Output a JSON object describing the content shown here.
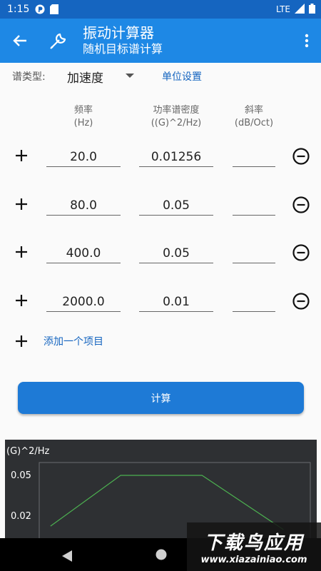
{
  "status": {
    "time": "1:15",
    "network": "LTE"
  },
  "app": {
    "title": "振动计算器",
    "subtitle": "随机目标谱计算"
  },
  "controls": {
    "type_label": "谱类型:",
    "type_value": "加速度",
    "unit_link": "单位设置"
  },
  "columns": [
    {
      "line1": "频率",
      "line2": "(Hz)"
    },
    {
      "line1": "功率谱密度",
      "line2": "((G)^2/Hz)"
    },
    {
      "line1": "斜率",
      "line2": "(dB/Oct)"
    }
  ],
  "rows": [
    {
      "freq": "20.0",
      "psd": "0.01256",
      "slope": ""
    },
    {
      "freq": "80.0",
      "psd": "0.05",
      "slope": ""
    },
    {
      "freq": "400.0",
      "psd": "0.05",
      "slope": ""
    },
    {
      "freq": "2000.0",
      "psd": "0.01",
      "slope": ""
    }
  ],
  "add_item": "添加一个项目",
  "calc_button": "计算",
  "chart_data": {
    "type": "line",
    "ylabel": "(G)^2/Hz",
    "y_ticks": [
      "0.05",
      "0.02"
    ],
    "series": [
      {
        "x": [
          20,
          80,
          400,
          2000
        ],
        "y": [
          0.01256,
          0.05,
          0.05,
          0.01
        ]
      }
    ],
    "line_color": "#4caf50",
    "background": "#2e3033"
  },
  "watermark": {
    "main": "下载鸟应用",
    "sub": "www.xiazainiao.com"
  }
}
